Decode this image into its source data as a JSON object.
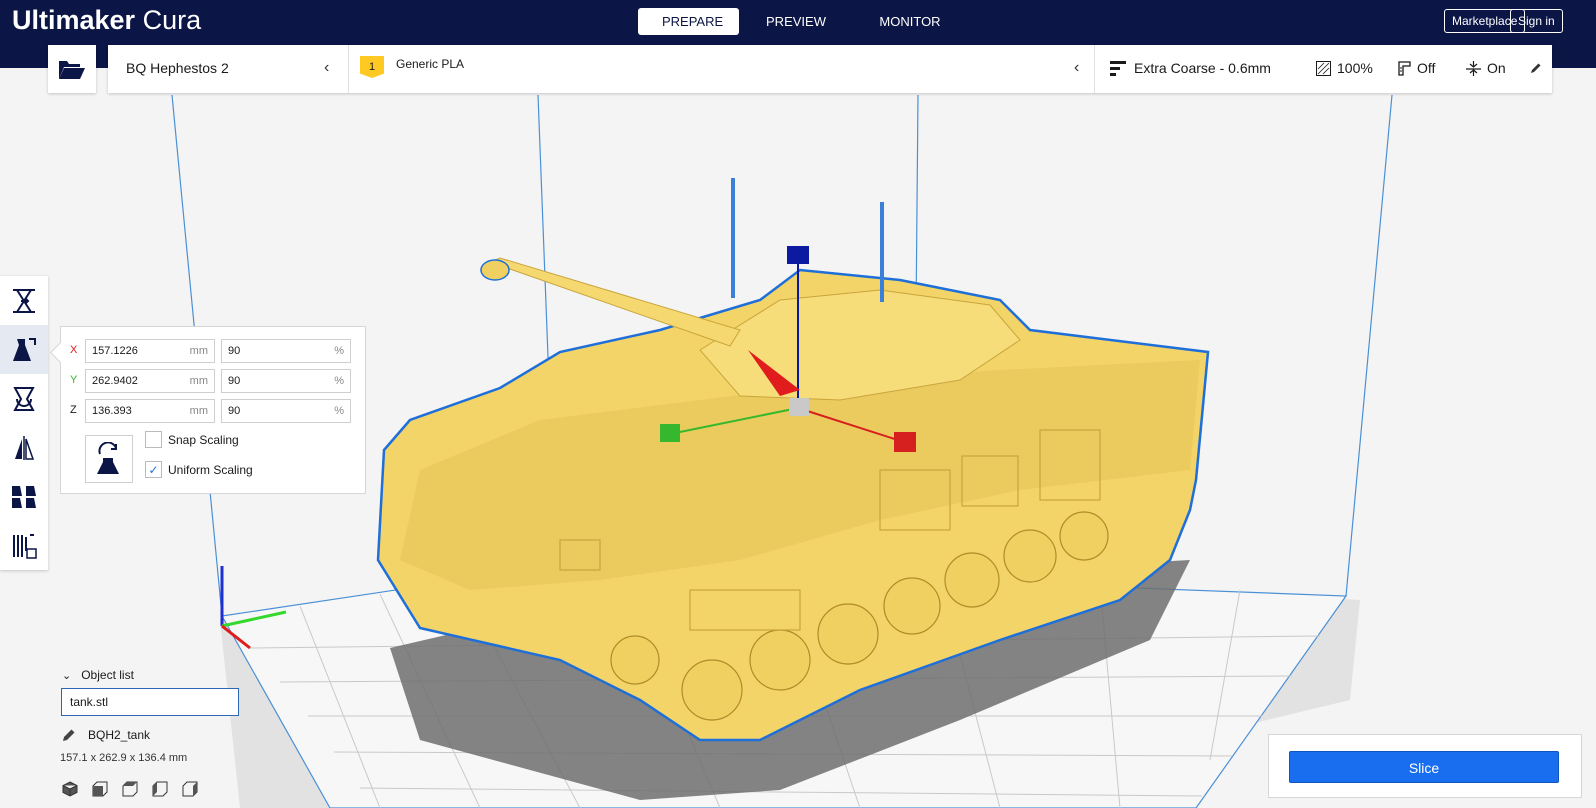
{
  "header": {
    "brand_bold": "Ultimaker",
    "brand_light": "Cura",
    "tabs": [
      {
        "label": "PREPARE",
        "active": true
      },
      {
        "label": "PREVIEW",
        "active": false
      },
      {
        "label": "MONITOR",
        "active": false
      }
    ],
    "marketplace_label": "Marketplace",
    "signin_label": "Sign in"
  },
  "topbar": {
    "open_icon": "folder-open-icon",
    "printer": "BQ Hephestos 2",
    "extruder_number": "1",
    "material": "Generic PLA",
    "profile": "Extra Coarse - 0.6mm",
    "infill": "100%",
    "support": "Off",
    "adhesion": "On"
  },
  "toolbar": {
    "tools": [
      {
        "name": "move-tool",
        "active": false
      },
      {
        "name": "scale-tool",
        "active": true
      },
      {
        "name": "rotate-tool",
        "active": false
      },
      {
        "name": "mirror-tool",
        "active": false
      },
      {
        "name": "per-model-settings-tool",
        "active": false
      },
      {
        "name": "support-blocker-tool",
        "active": false
      }
    ]
  },
  "scale_panel": {
    "rows": [
      {
        "axis": "X",
        "size": "157.1226",
        "size_unit": "mm",
        "percent": "90",
        "percent_unit": "%",
        "color": "#e01c1c"
      },
      {
        "axis": "Y",
        "size": "262.9402",
        "size_unit": "mm",
        "percent": "90",
        "percent_unit": "%",
        "color": "#35b82e"
      },
      {
        "axis": "Z",
        "size": "136.393",
        "size_unit": "mm",
        "percent": "90",
        "percent_unit": "%",
        "color": "#1a1a1a"
      }
    ],
    "snap_scaling_label": "Snap Scaling",
    "snap_scaling_checked": false,
    "uniform_scaling_label": "Uniform Scaling",
    "uniform_scaling_checked": true
  },
  "object_list": {
    "title": "Object list",
    "items": [
      "tank.stl"
    ],
    "job_name": "BQH2_tank",
    "dimensions": "157.1 x 262.9 x 136.4 mm"
  },
  "slice_panel": {
    "slice_label": "Slice"
  },
  "colors": {
    "header_bg": "#0b1546",
    "accent": "#196ef0",
    "model": "#f6d96c",
    "model_outline": "#1e6fd9"
  }
}
